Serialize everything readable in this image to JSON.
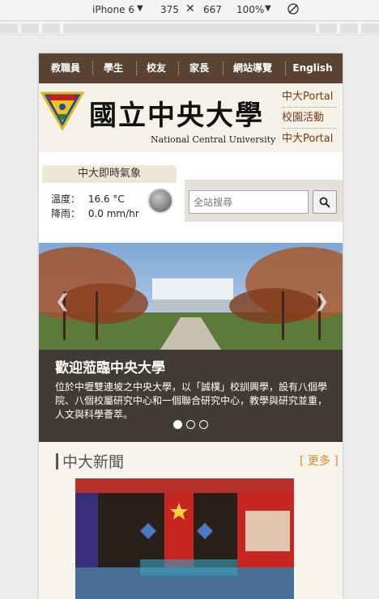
{
  "devtools": {
    "device": "iPhone 6",
    "width": "375",
    "height": "667",
    "zoom": "100%"
  },
  "topnav": {
    "items": [
      "教職員",
      "學生",
      "校友",
      "家長",
      "網站導覽",
      "English"
    ]
  },
  "header": {
    "logo_cn": "國立中央大學",
    "logo_en": "National Central University",
    "side_links": [
      "中大Portal",
      "校園活動",
      "中大Portal"
    ]
  },
  "weather": {
    "title": "中大即時氣象",
    "temp_label": "溫度：",
    "temp_value": "16.6 °C",
    "rain_label": "降雨：",
    "rain_value": "0.0 mm/hr"
  },
  "search": {
    "placeholder": "全站搜尋"
  },
  "slider": {
    "title": "歡迎蒞臨中央大學",
    "text": "位於中壢雙連坡之中央大學，以「誠樸」校訓興學，設有八個學院、八個校屬研究中心和一個聯合研究中心，教學與研究並重，人文與科學薈萃。",
    "active_slide": 1,
    "slide_count": 3
  },
  "news": {
    "title": "中大新聞",
    "more": "[ 更多 ]"
  },
  "colors": {
    "nav_bg": "#5a4330",
    "caption_bg": "#423a34",
    "accent": "#e08a1e"
  }
}
